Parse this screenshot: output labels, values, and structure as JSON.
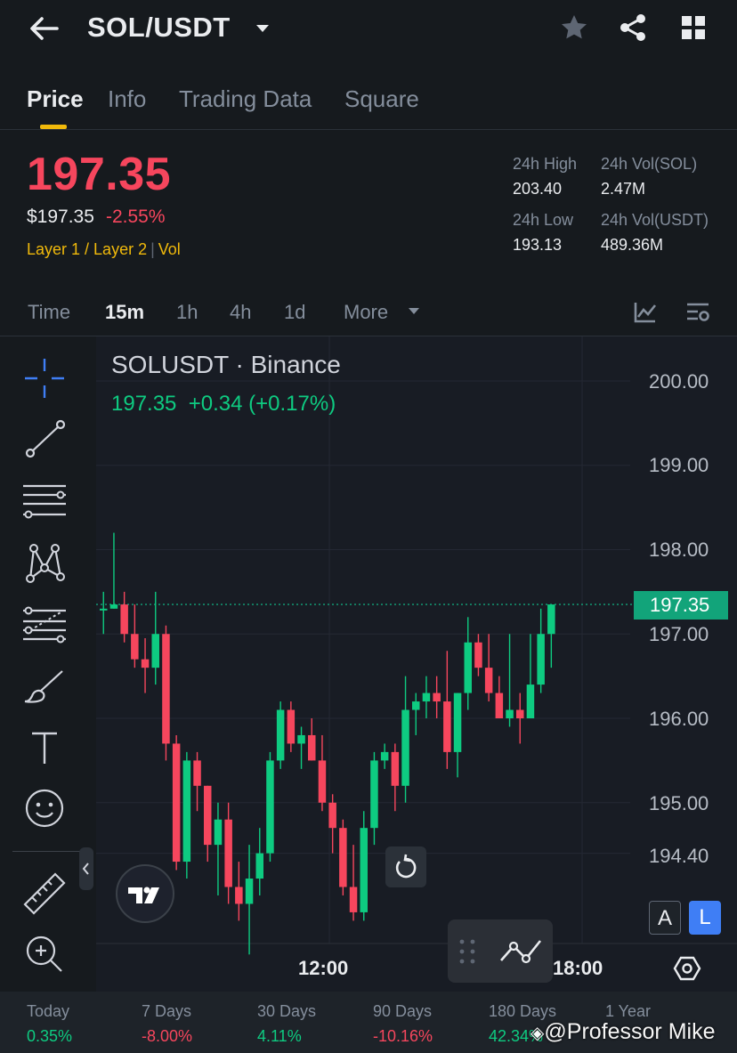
{
  "header": {
    "pair": "SOL/USDT",
    "icons": [
      "back-arrow-icon",
      "caret-down-icon",
      "star-icon",
      "share-icon",
      "grid-icon"
    ]
  },
  "tabs": [
    {
      "label": "Price",
      "active": true
    },
    {
      "label": "Info",
      "active": false
    },
    {
      "label": "Trading Data",
      "active": false
    },
    {
      "label": "Square",
      "active": false
    }
  ],
  "price": {
    "last": "197.35",
    "usd": "$197.35",
    "change_pct": "-2.55%",
    "tag1": "Layer 1 / Layer 2",
    "tag2": "Vol",
    "color_down": "#f6465d",
    "color_up": "#0ecb81"
  },
  "stats": {
    "high_label": "24h High",
    "high_value": "203.40",
    "low_label": "24h Low",
    "low_value": "193.13",
    "vol_sol_label": "24h Vol(SOL)",
    "vol_sol_value": "2.47M",
    "vol_usdt_label": "24h Vol(USDT)",
    "vol_usdt_value": "489.36M"
  },
  "timeframes": {
    "items": [
      "Time",
      "15m",
      "1h",
      "4h",
      "1d"
    ],
    "active": "15m",
    "more_label": "More"
  },
  "chart": {
    "title": "SOLUSDT · Binance",
    "sub_price": "197.35",
    "sub_change": "+0.34 (+0.17%)",
    "last_tag": "197.35",
    "price_labels": [
      "200.00",
      "199.00",
      "198.00",
      "197.00",
      "196.00",
      "195.00",
      "194.40"
    ],
    "time_labels": [
      "12:00",
      "18:00"
    ],
    "btn_a": "A",
    "btn_l": "L"
  },
  "chart_data": {
    "type": "candlestick",
    "interval": "15m",
    "ylim": [
      193.1,
      200.3
    ],
    "last_price": 197.35,
    "x_ticks": [
      "12:00",
      "18:00"
    ],
    "y_ticks": [
      200.0,
      199.0,
      198.0,
      197.0,
      196.0,
      195.0,
      194.4
    ],
    "candles": [
      [
        197.3,
        197.5,
        197.0,
        197.3
      ],
      [
        197.3,
        198.2,
        197.3,
        197.35
      ],
      [
        197.35,
        197.5,
        196.9,
        197.0
      ],
      [
        197.0,
        197.35,
        196.6,
        196.7
      ],
      [
        196.7,
        196.95,
        196.3,
        196.6
      ],
      [
        196.6,
        197.5,
        196.4,
        197.0
      ],
      [
        197.0,
        197.1,
        195.5,
        195.7
      ],
      [
        195.7,
        195.8,
        194.2,
        194.3
      ],
      [
        194.3,
        195.6,
        194.1,
        195.5
      ],
      [
        195.5,
        195.6,
        194.9,
        195.2
      ],
      [
        195.2,
        195.2,
        194.3,
        194.5
      ],
      [
        194.5,
        195.0,
        193.9,
        194.8
      ],
      [
        194.8,
        195.0,
        193.8,
        194.0
      ],
      [
        194.0,
        194.3,
        193.6,
        193.8
      ],
      [
        193.8,
        194.5,
        193.2,
        194.1
      ],
      [
        194.1,
        194.7,
        193.9,
        194.4
      ],
      [
        194.4,
        195.6,
        194.3,
        195.5
      ],
      [
        195.5,
        196.2,
        195.4,
        196.1
      ],
      [
        196.1,
        196.2,
        195.6,
        195.7
      ],
      [
        195.7,
        195.9,
        195.4,
        195.8
      ],
      [
        195.8,
        196.0,
        195.5,
        195.5
      ],
      [
        195.5,
        195.8,
        194.9,
        195.0
      ],
      [
        195.0,
        195.1,
        194.4,
        194.7
      ],
      [
        194.7,
        194.8,
        193.9,
        194.0
      ],
      [
        194.0,
        194.5,
        193.6,
        193.7
      ],
      [
        193.7,
        194.9,
        193.6,
        194.7
      ],
      [
        194.7,
        195.6,
        194.5,
        195.5
      ],
      [
        195.5,
        195.7,
        195.4,
        195.6
      ],
      [
        195.6,
        195.7,
        194.9,
        195.2
      ],
      [
        195.2,
        196.5,
        195.0,
        196.1
      ],
      [
        196.1,
        196.3,
        195.8,
        196.2
      ],
      [
        196.2,
        196.5,
        196.0,
        196.3
      ],
      [
        196.3,
        196.5,
        196.0,
        196.2
      ],
      [
        196.2,
        196.8,
        195.4,
        195.6
      ],
      [
        195.6,
        196.3,
        195.3,
        196.3
      ],
      [
        196.3,
        197.2,
        196.1,
        196.9
      ],
      [
        196.9,
        197.0,
        196.5,
        196.6
      ],
      [
        196.6,
        197.0,
        196.2,
        196.3
      ],
      [
        196.3,
        196.5,
        196.0,
        196.0
      ],
      [
        196.0,
        197.0,
        195.9,
        196.1
      ],
      [
        196.1,
        196.3,
        195.7,
        196.0
      ],
      [
        196.0,
        197.0,
        196.0,
        196.4
      ],
      [
        196.4,
        197.3,
        196.3,
        197.0
      ],
      [
        197.0,
        197.35,
        196.6,
        197.35
      ]
    ]
  },
  "toolbar": {
    "icons": [
      "crosshair-icon",
      "trend-line-icon",
      "horizontal-lines-icon",
      "pattern-icon",
      "fib-channel-icon",
      "brush-icon",
      "text-icon",
      "emoji-icon",
      "ruler-icon",
      "zoom-in-icon"
    ]
  },
  "performance": [
    {
      "label": "Today",
      "value": "0.35%",
      "dir": "up"
    },
    {
      "label": "7 Days",
      "value": "-8.00%",
      "dir": "down"
    },
    {
      "label": "30 Days",
      "value": "4.11%",
      "dir": "up"
    },
    {
      "label": "90 Days",
      "value": "-10.16%",
      "dir": "down"
    },
    {
      "label": "180 Days",
      "value": "42.34%",
      "dir": "up"
    },
    {
      "label": "1 Year",
      "value": "",
      "dir": "up"
    }
  ],
  "watermark": "@Professor Mike"
}
